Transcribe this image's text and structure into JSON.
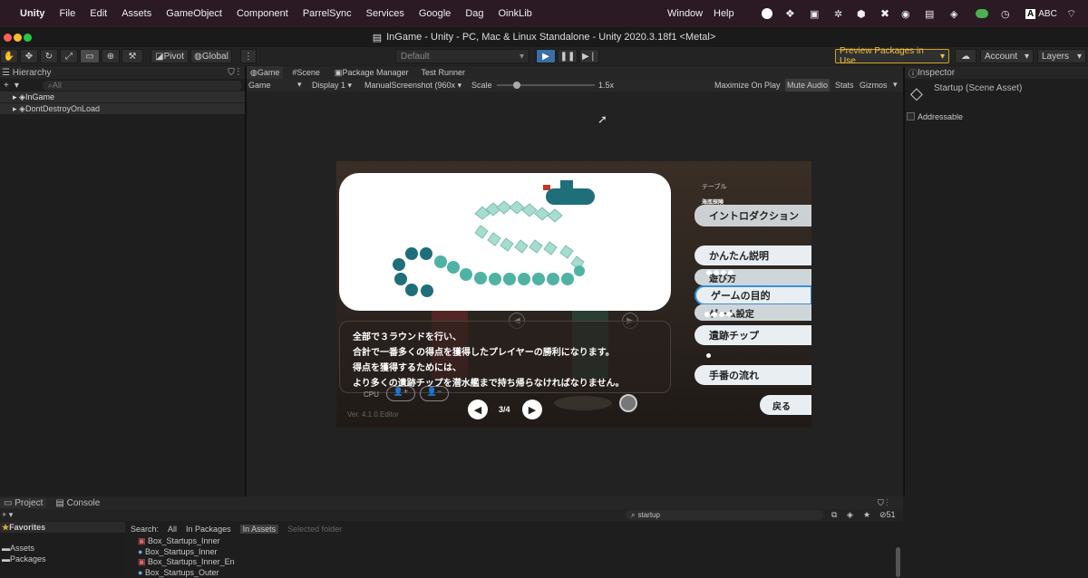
{
  "menubar": {
    "app": "Unity",
    "items": [
      "File",
      "Edit",
      "Assets",
      "GameObject",
      "Component",
      "ParrelSync",
      "Services",
      "Google",
      "Dag",
      "OinkLib"
    ],
    "right": [
      "Window",
      "Help"
    ],
    "input": "ABC"
  },
  "window_title": "InGame - Unity - PC, Mac & Linux Standalone - Unity 2020.3.18f1 <Metal>",
  "toolbar": {
    "pivot": "Pivot",
    "global": "Global",
    "layout_default": "Default",
    "preview": "Preview Packages in Use",
    "account": "Account",
    "layers": "Layers"
  },
  "hierarchy": {
    "title": "Hierarchy",
    "plus": "+",
    "search_placeholder": "All",
    "items": [
      "InGame",
      "DontDestroyOnLoad"
    ]
  },
  "center_tabs": [
    "Game",
    "Scene",
    "Package Manager",
    "Test Runner"
  ],
  "game_toolbar": {
    "view": "Game",
    "display": "Display 1",
    "resolution": "ManualScreenshot (960x",
    "scale_label": "Scale",
    "scale_value": "1.5x",
    "options": [
      "Maximize On Play",
      "Mute Audio",
      "Stats",
      "Gizmos"
    ]
  },
  "inspector": {
    "title": "Inspector",
    "asset": "Startup (Scene Asset)",
    "addressable": "Addressable"
  },
  "game": {
    "top_label": "テーブル",
    "top_sub": "海底探険",
    "top_btn": "イントロダクション",
    "menu": [
      "かんたん説明",
      "遊び方",
      "ゲームの目的",
      "ゲーム設定",
      "遺跡チップ",
      "手番の流れ"
    ],
    "text": [
      "全部で３ラウンドを行い、",
      "合計で一番多くの得点を獲得したプレイヤーの勝利になります。",
      "得点を獲得するためには、",
      "より多くの遺跡チップを潜水艦まで持ち帰らなければなりません。"
    ],
    "cpu": "CPU",
    "page": "3/4",
    "back": "戻る",
    "version": "Ver. 4.1.0.Editor"
  },
  "bottom": {
    "tabs": [
      "Project",
      "Console"
    ],
    "plus": "+",
    "favorites": "Favorites",
    "tree": [
      "Assets",
      "Packages"
    ],
    "search_label": "Search:",
    "scopes": [
      "All",
      "In Packages",
      "In Assets",
      "Selected folder"
    ],
    "query": "startup",
    "count": "51",
    "files": [
      "Box_Startups_Inner",
      "Box_Startups_Inner",
      "Box_Startups_Inner_En",
      "Box_Startups_Outer"
    ]
  }
}
